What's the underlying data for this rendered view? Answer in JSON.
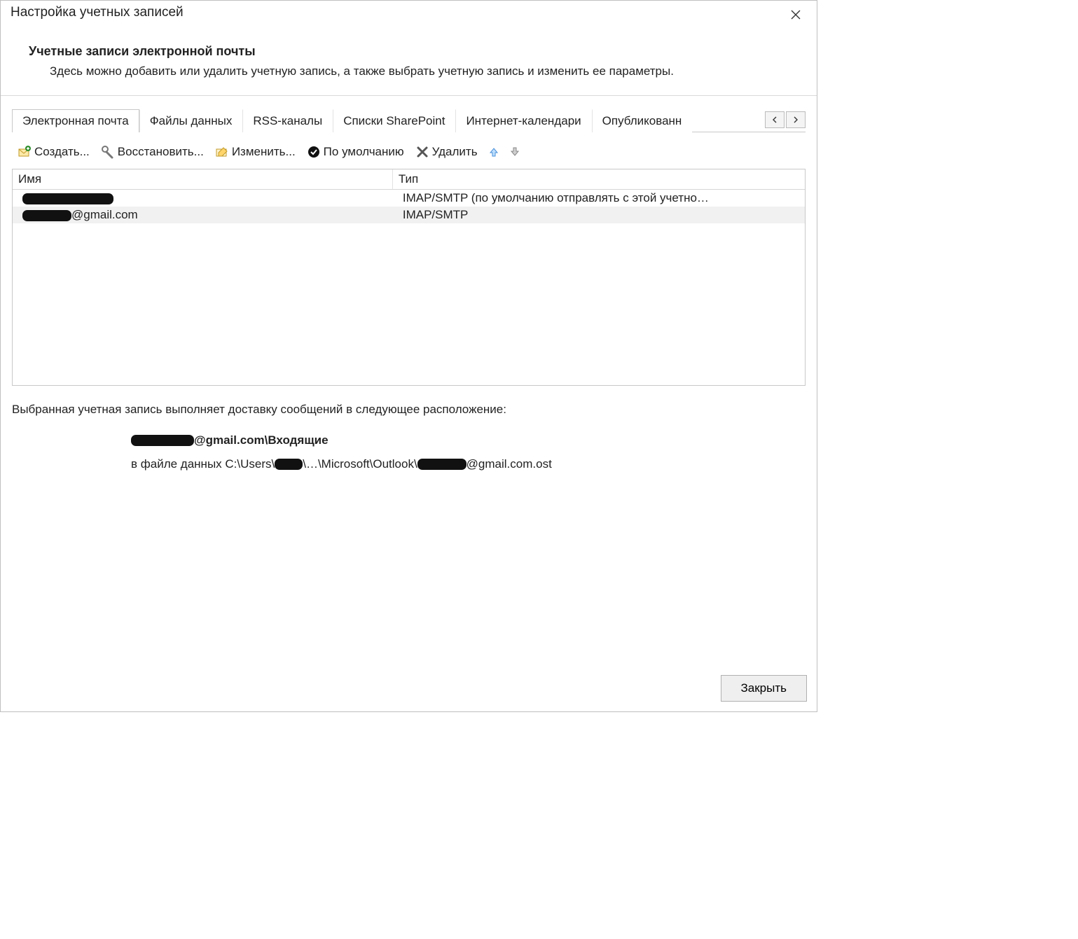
{
  "window": {
    "title": "Настройка учетных записей"
  },
  "header": {
    "title": "Учетные записи электронной почты",
    "description": "Здесь можно добавить или удалить учетную запись, а также выбрать учетную запись и изменить ее параметры."
  },
  "tabs": {
    "items": [
      "Электронная почта",
      "Файлы данных",
      "RSS-каналы",
      "Списки SharePoint",
      "Интернет-календари",
      "Опубликованн"
    ],
    "active_index": 0
  },
  "toolbar": {
    "new": "Создать...",
    "repair": "Восстановить...",
    "change": "Изменить...",
    "set_default": "По умолчанию",
    "remove": "Удалить"
  },
  "table": {
    "columns": {
      "name": "Имя",
      "type": "Тип"
    },
    "rows": [
      {
        "name_redacted": true,
        "name_suffix": "",
        "type": "IMAP/SMTP (по умолчанию отправлять с этой учетно…"
      },
      {
        "name_redacted": true,
        "name_suffix": "@gmail.com",
        "type": "IMAP/SMTP"
      }
    ],
    "selected_index": 1
  },
  "delivery": {
    "intro": "Выбранная учетная запись выполняет доставку сообщений в следующее расположение:",
    "location_suffix": "@gmail.com\\Входящие",
    "path_prefix": "в файле данных C:\\Users\\",
    "path_mid": "\\…\\Microsoft\\Outlook\\",
    "path_suffix": "@gmail.com.ost"
  },
  "footer": {
    "close": "Закрыть"
  }
}
